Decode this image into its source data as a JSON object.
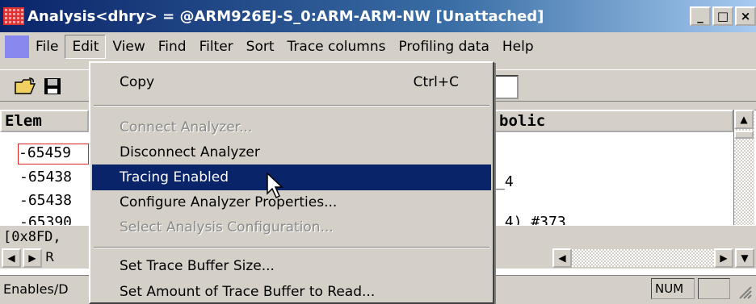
{
  "window": {
    "title": "Analysis<dhry> = @ARM926EJ-S_0:ARM-ARM-NW [Unattached]",
    "buttons": [
      "_",
      "□",
      "×"
    ]
  },
  "menubar": {
    "items": [
      "File",
      "Edit",
      "View",
      "Find",
      "Filter",
      "Sort",
      "Trace columns",
      "Profiling data",
      "Help"
    ],
    "active": "Edit"
  },
  "table": {
    "col_elem": "Elem",
    "col_symbolic": "bolic",
    "rows": [
      "-65459",
      "-65438",
      "-65438",
      "-65390"
    ],
    "symbolic_rows": [
      "_4",
      "_4) #373"
    ]
  },
  "info_bar": "[0x8FD,",
  "tab_label": "R",
  "status": {
    "text": "Enables/D",
    "num": "NUM"
  },
  "edit_menu": {
    "items": [
      {
        "label": "Copy",
        "shortcut": "Ctrl+C",
        "state": "enabled"
      },
      {
        "label": "Connect Analyzer...",
        "state": "disabled"
      },
      {
        "label": "Disconnect Analyzer",
        "state": "enabled"
      },
      {
        "label": "Tracing Enabled",
        "state": "highlighted"
      },
      {
        "label": "Configure Analyzer Properties...",
        "state": "enabled"
      },
      {
        "label": "Select Analysis Configuration...",
        "state": "disabled"
      },
      {
        "label": "Set Trace Buffer Size...",
        "state": "enabled"
      },
      {
        "label": "Set Amount of Trace Buffer to Read...",
        "state": "enabled"
      }
    ]
  },
  "colors": {
    "highlight": "#0a246a",
    "title_start": "#0a246a",
    "title_end": "#a6caf0",
    "face": "#d4d0c8"
  }
}
